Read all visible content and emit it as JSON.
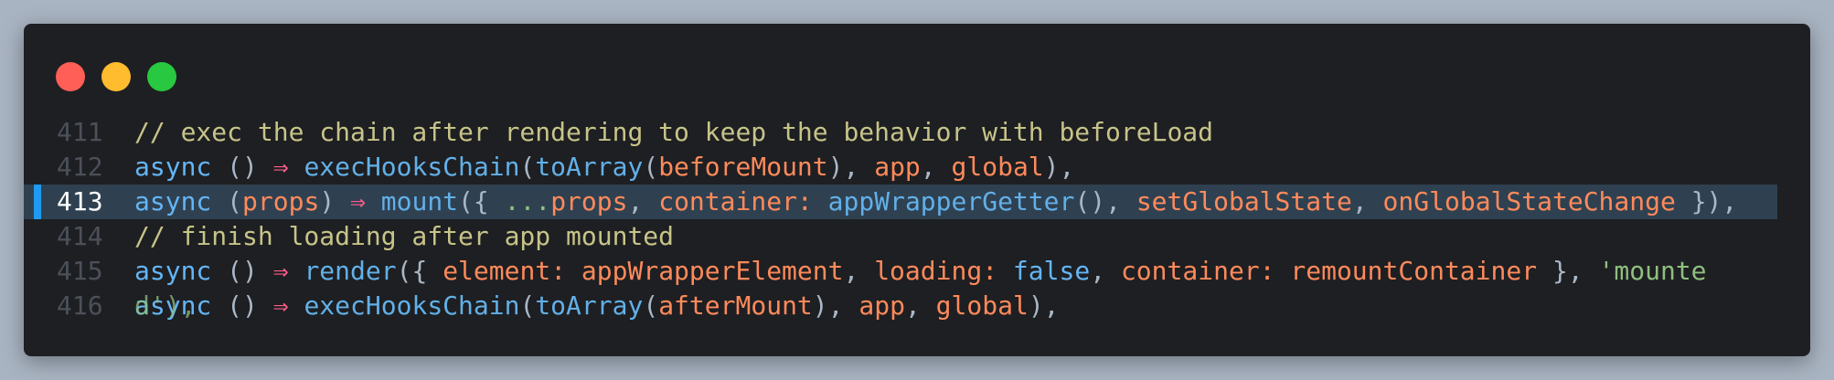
{
  "window": {
    "controls": [
      "close",
      "minimize",
      "maximize"
    ]
  },
  "lines": [
    {
      "number": "411",
      "tokens": [
        {
          "t": "// exec the chain after rendering to keep the behavior with beforeLoad",
          "c": "comment"
        }
      ]
    },
    {
      "number": "412",
      "tokens": [
        {
          "t": "async",
          "c": "kw"
        },
        {
          "t": " () ",
          "c": "punc"
        },
        {
          "t": "⇒",
          "c": "arrow"
        },
        {
          "t": " ",
          "c": "punc"
        },
        {
          "t": "execHooksChain",
          "c": "fn"
        },
        {
          "t": "(",
          "c": "punc"
        },
        {
          "t": "toArray",
          "c": "fn"
        },
        {
          "t": "(",
          "c": "punc"
        },
        {
          "t": "beforeMount",
          "c": "ident"
        },
        {
          "t": "), ",
          "c": "punc"
        },
        {
          "t": "app",
          "c": "ident"
        },
        {
          "t": ", ",
          "c": "punc"
        },
        {
          "t": "global",
          "c": "ident"
        },
        {
          "t": "),",
          "c": "punc"
        }
      ]
    },
    {
      "number": "413",
      "active": true,
      "tokens": [
        {
          "t": "async",
          "c": "kw"
        },
        {
          "t": " (",
          "c": "punc"
        },
        {
          "t": "props",
          "c": "ident"
        },
        {
          "t": ") ",
          "c": "punc"
        },
        {
          "t": "⇒",
          "c": "arrow"
        },
        {
          "t": " ",
          "c": "punc"
        },
        {
          "t": "mount",
          "c": "fn"
        },
        {
          "t": "({ ",
          "c": "punc"
        },
        {
          "t": "...",
          "c": "spread"
        },
        {
          "t": "props",
          "c": "ident"
        },
        {
          "t": ", ",
          "c": "punc"
        },
        {
          "t": "container:",
          "c": "prop"
        },
        {
          "t": " ",
          "c": "punc"
        },
        {
          "t": "appWrapperGetter",
          "c": "fn"
        },
        {
          "t": "(), ",
          "c": "punc"
        },
        {
          "t": "setGlobalState",
          "c": "ident"
        },
        {
          "t": ", ",
          "c": "punc"
        },
        {
          "t": "onGlobalStateChange",
          "c": "ident"
        },
        {
          "t": " }),",
          "c": "punc"
        }
      ]
    },
    {
      "number": "414",
      "tokens": [
        {
          "t": "// finish loading after app mounted",
          "c": "comment"
        }
      ]
    },
    {
      "number": "415",
      "tokens": [
        {
          "t": "async",
          "c": "kw"
        },
        {
          "t": " () ",
          "c": "punc"
        },
        {
          "t": "⇒",
          "c": "arrow"
        },
        {
          "t": " ",
          "c": "punc"
        },
        {
          "t": "render",
          "c": "fn"
        },
        {
          "t": "({ ",
          "c": "punc"
        },
        {
          "t": "element:",
          "c": "prop"
        },
        {
          "t": " ",
          "c": "punc"
        },
        {
          "t": "appWrapperElement",
          "c": "ident"
        },
        {
          "t": ", ",
          "c": "punc"
        },
        {
          "t": "loading:",
          "c": "prop"
        },
        {
          "t": " ",
          "c": "punc"
        },
        {
          "t": "false",
          "c": "bool"
        },
        {
          "t": ", ",
          "c": "punc"
        },
        {
          "t": "container:",
          "c": "prop"
        },
        {
          "t": " ",
          "c": "punc"
        },
        {
          "t": "remountContainer",
          "c": "ident"
        },
        {
          "t": " }, ",
          "c": "punc"
        },
        {
          "t": "'mounte",
          "c": "str"
        }
      ]
    },
    {
      "number": "416",
      "overlay": [
        {
          "t": "d'),",
          "c": "str"
        }
      ],
      "tokens": [
        {
          "t": "async",
          "c": "kw"
        },
        {
          "t": " () ",
          "c": "punc"
        },
        {
          "t": "⇒",
          "c": "arrow"
        },
        {
          "t": " ",
          "c": "punc"
        },
        {
          "t": "execHooksChain",
          "c": "fn"
        },
        {
          "t": "(",
          "c": "punc"
        },
        {
          "t": "toArray",
          "c": "fn"
        },
        {
          "t": "(",
          "c": "punc"
        },
        {
          "t": "afterMount",
          "c": "ident"
        },
        {
          "t": "), ",
          "c": "punc"
        },
        {
          "t": "app",
          "c": "ident"
        },
        {
          "t": ", ",
          "c": "punc"
        },
        {
          "t": "global",
          "c": "ident"
        },
        {
          "t": "),",
          "c": "punc"
        }
      ]
    }
  ]
}
